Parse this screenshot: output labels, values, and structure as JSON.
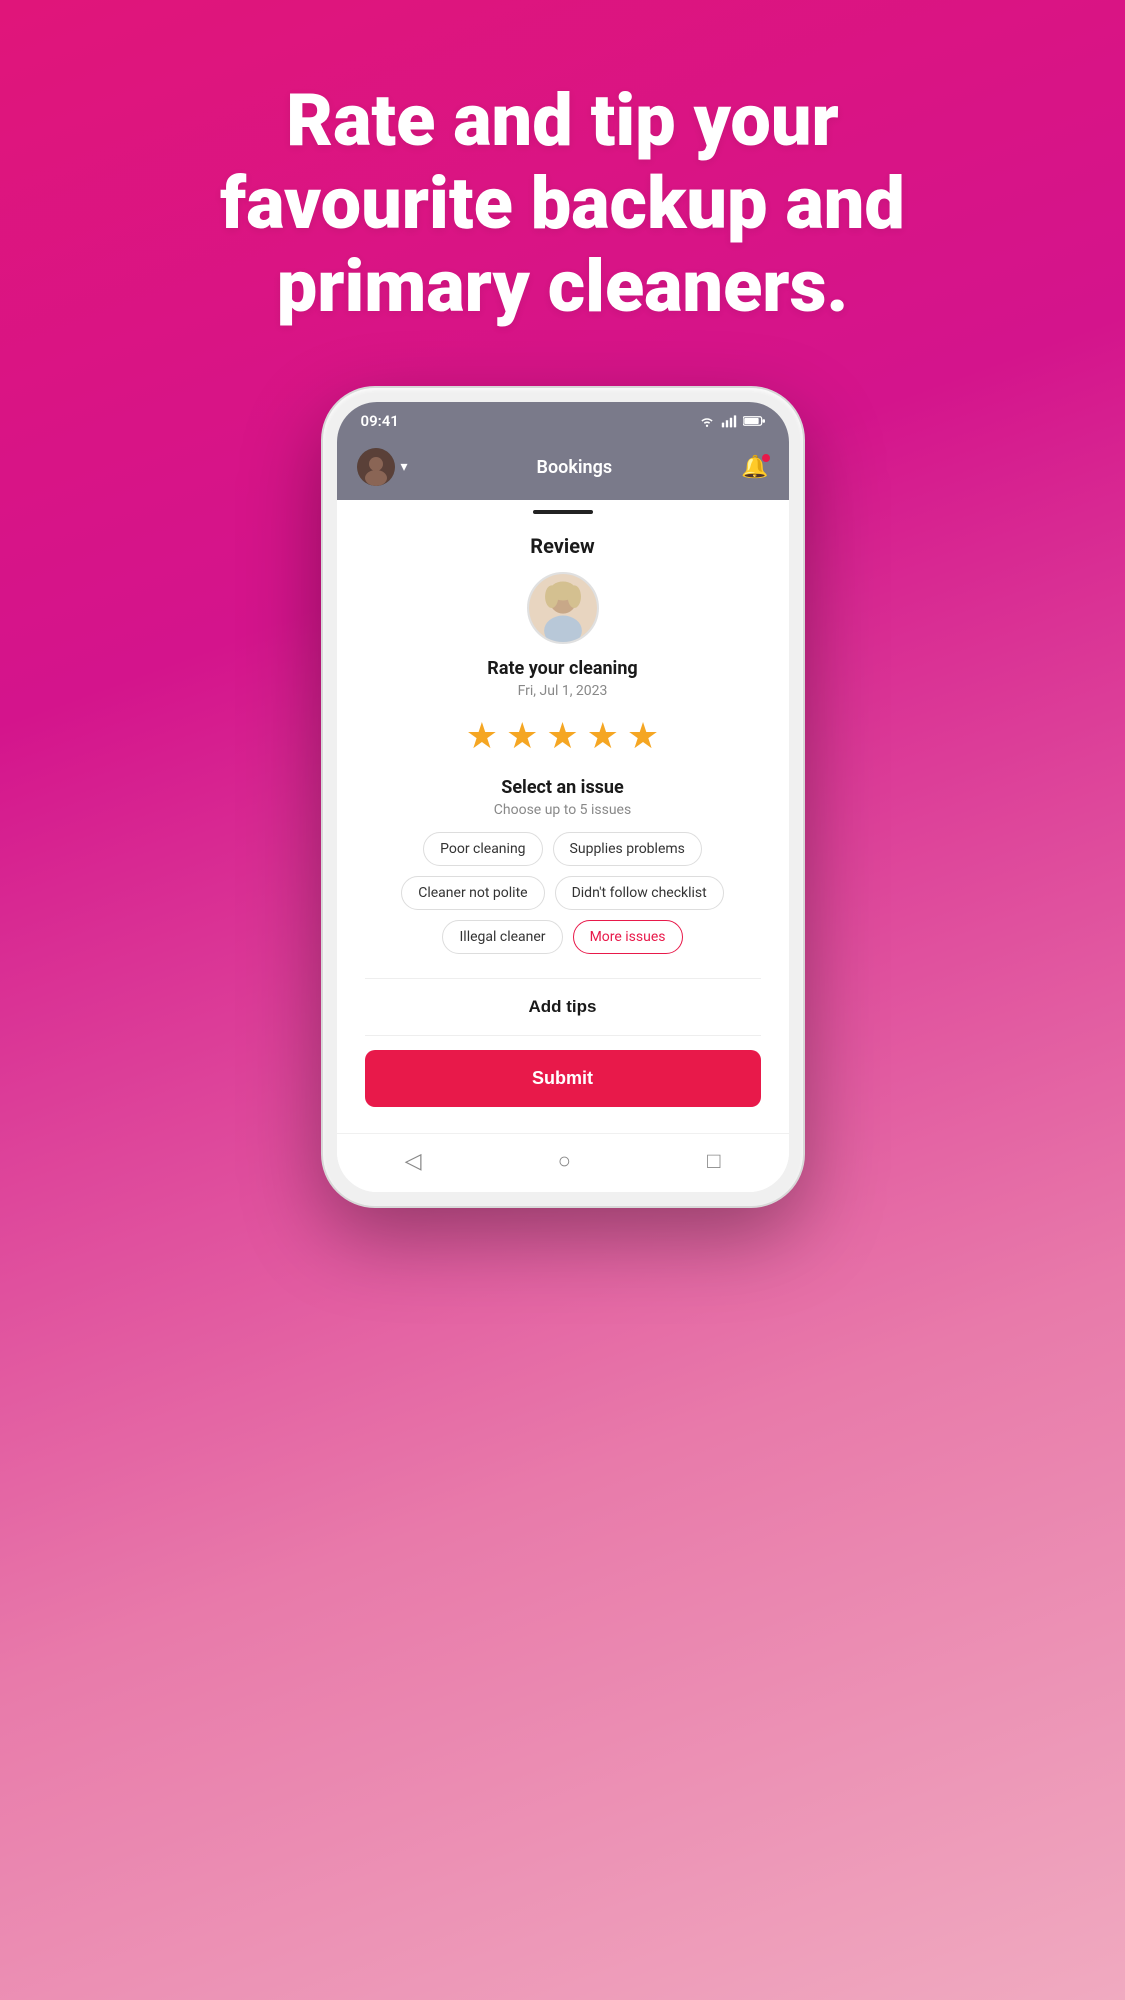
{
  "headline": {
    "line1": "Rate and tip your",
    "line2": "favourite backup and",
    "line3": "primary cleaners."
  },
  "status_bar": {
    "time": "09:41",
    "wifi": "▲",
    "signal": "▲",
    "battery": "▮"
  },
  "header": {
    "title": "Bookings"
  },
  "screen": {
    "review_title": "Review",
    "rate_label": "Rate your cleaning",
    "rate_date": "Fri, Jul 1, 2023",
    "stars_count": 5,
    "select_issue_title": "Select an issue",
    "select_issue_subtitle": "Choose up to 5 issues",
    "issues": [
      {
        "label": "Poor cleaning",
        "pink": false
      },
      {
        "label": "Supplies problems",
        "pink": false
      },
      {
        "label": "Cleaner not polite",
        "pink": false
      },
      {
        "label": "Didn't follow checklist",
        "pink": false
      },
      {
        "label": "Illegal cleaner",
        "pink": false
      },
      {
        "label": "More issues",
        "pink": true
      }
    ],
    "add_tips_label": "Add tips",
    "submit_label": "Submit"
  }
}
